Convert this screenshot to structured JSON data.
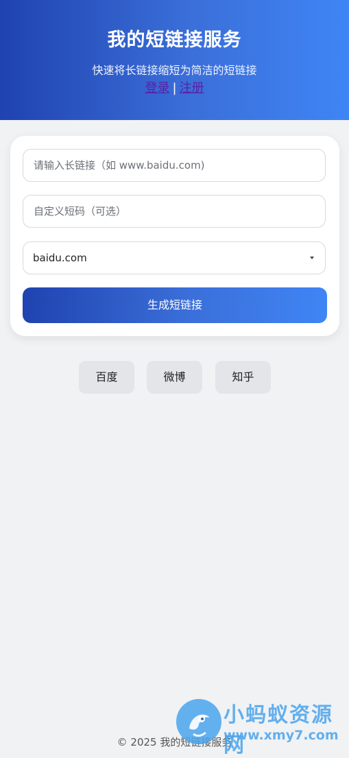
{
  "header": {
    "title": "我的短链接服务",
    "subtitle": "快速将长链接缩短为简洁的短链接",
    "login_label": "登录",
    "separator": "|",
    "register_label": "注册"
  },
  "form": {
    "long_url_placeholder": "请输入长链接（如 www.baidu.com)",
    "custom_code_placeholder": "自定义短码（可选）",
    "domain_selected": "baidu.com",
    "submit_label": "生成短链接"
  },
  "quick_links": [
    {
      "label": "百度"
    },
    {
      "label": "微博"
    },
    {
      "label": "知乎"
    }
  ],
  "footer": {
    "text": "© 2025 我的短链接服务"
  },
  "watermark": {
    "name": "小蚂蚁资源网",
    "url": "www.xmy7.com"
  },
  "colors": {
    "brand_start": "#1f43b0",
    "brand_end": "#3f85f5",
    "page_background": "#f1f2f4"
  }
}
